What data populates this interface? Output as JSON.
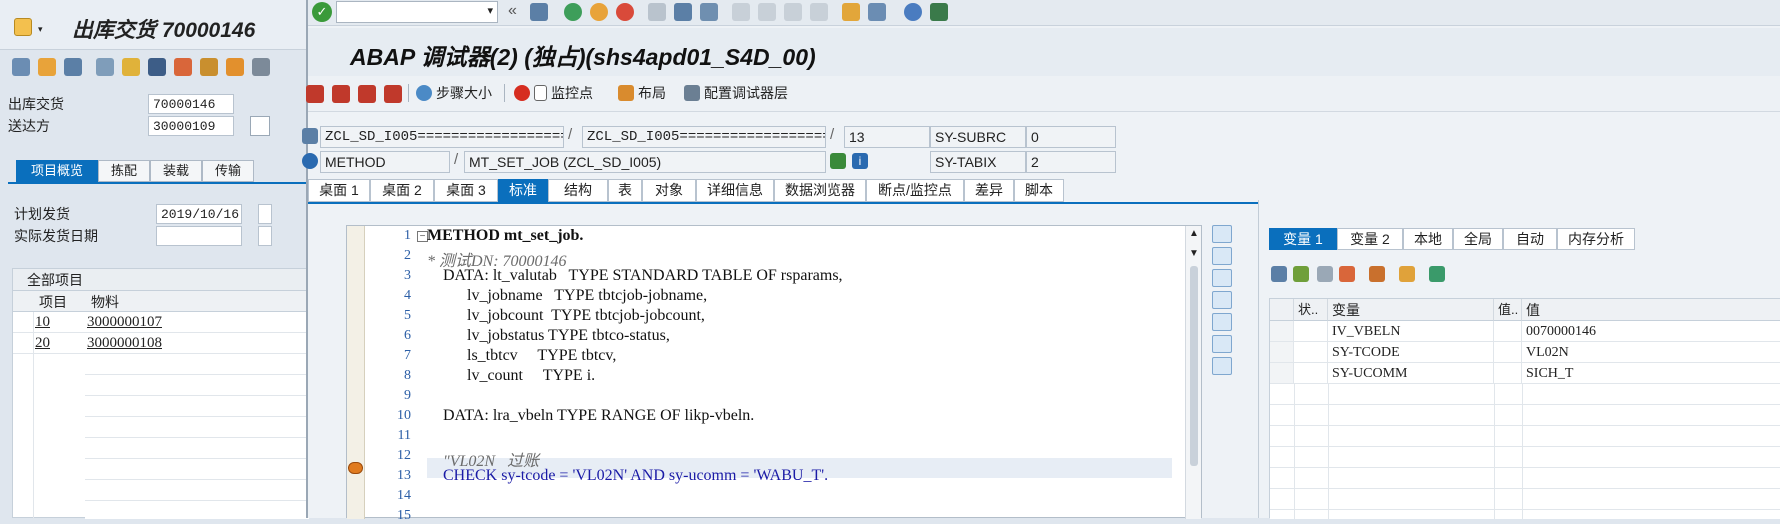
{
  "bg_window": {
    "title": "出库交货 70000146",
    "fields": [
      {
        "label": "出库交货",
        "value": "70000146"
      },
      {
        "label": "送达方",
        "value": "30000109"
      }
    ],
    "tabs": [
      "项目概览",
      "拣配",
      "装载",
      "传输"
    ],
    "date_fields": [
      {
        "label": "计划发货",
        "value": "2019/10/16"
      },
      {
        "label": "实际发货日期",
        "value": ""
      }
    ],
    "items_section_label": "全部项目",
    "items_columns": [
      "项目",
      "物料"
    ],
    "items": [
      {
        "item": "10",
        "material": "3000000107"
      },
      {
        "item": "20",
        "material": "3000000108"
      }
    ]
  },
  "debugger": {
    "title": "ABAP 调试器(2) (独占)(shs4apd01_S4D_00)",
    "toolbar": {
      "step_size": "步骤大小",
      "watchpoint": "监控点",
      "layout": "布局",
      "configure_layers": "配置调试器层"
    },
    "info": {
      "program1": "ZCL_SD_I005=====================...",
      "program2": "ZCL_SD_I005=====================...",
      "line": "13",
      "sy_subrc_label": "SY-SUBRC",
      "sy_subrc_value": "0",
      "type": "METHOD",
      "method": "MT_SET_JOB (ZCL_SD_I005)",
      "sy_tabix_label": "SY-TABIX",
      "sy_tabix_value": "2"
    },
    "tabs": [
      "桌面 1",
      "桌面 2",
      "桌面 3",
      "标准",
      "结构",
      "表",
      "对象",
      "详细信息",
      "数据浏览器",
      "断点/监控点",
      "差异",
      "脚本"
    ],
    "active_tab": "标准",
    "code_lines": [
      {
        "n": "1",
        "t": "METHOD mt_set_job."
      },
      {
        "n": "2",
        "t": "* 测试DN: 70000146"
      },
      {
        "n": "3",
        "t": "    DATA: lt_valutab   TYPE STANDARD TABLE OF rsparams,"
      },
      {
        "n": "4",
        "t": "          lv_jobname   TYPE tbtcjob-jobname,"
      },
      {
        "n": "5",
        "t": "          lv_jobcount  TYPE tbtcjob-jobcount,"
      },
      {
        "n": "6",
        "t": "          lv_jobstatus TYPE tbtco-status,"
      },
      {
        "n": "7",
        "t": "          ls_tbtcv     TYPE tbtcv,"
      },
      {
        "n": "8",
        "t": "          lv_count     TYPE i."
      },
      {
        "n": "9",
        "t": ""
      },
      {
        "n": "10",
        "t": "    DATA: lra_vbeln TYPE RANGE OF likp-vbeln."
      },
      {
        "n": "11",
        "t": ""
      },
      {
        "n": "12",
        "t": "    \"VL02N   过账"
      },
      {
        "n": "13",
        "t": "    CHECK sy-tcode = 'VL02N' AND sy-ucomm = 'WABU_T'."
      },
      {
        "n": "14",
        "t": ""
      },
      {
        "n": "15",
        "t": ""
      }
    ],
    "var_tabs": [
      "变量 1",
      "变量 2",
      "本地",
      "全局",
      "自动",
      "内存分析"
    ],
    "var_columns": [
      "状..",
      "变量",
      "值..",
      "值"
    ],
    "variables": [
      {
        "name": "IV_VBELN",
        "value": "0070000146"
      },
      {
        "name": "SY-TCODE",
        "value": "VL02N"
      },
      {
        "name": "SY-UCOMM",
        "value": "SICH_T"
      }
    ]
  },
  "colors": {
    "accent": "#0a6fbd",
    "keyword": "#1a1aa6",
    "comment": "#6b6b6b",
    "string": "#1c6f1c"
  }
}
